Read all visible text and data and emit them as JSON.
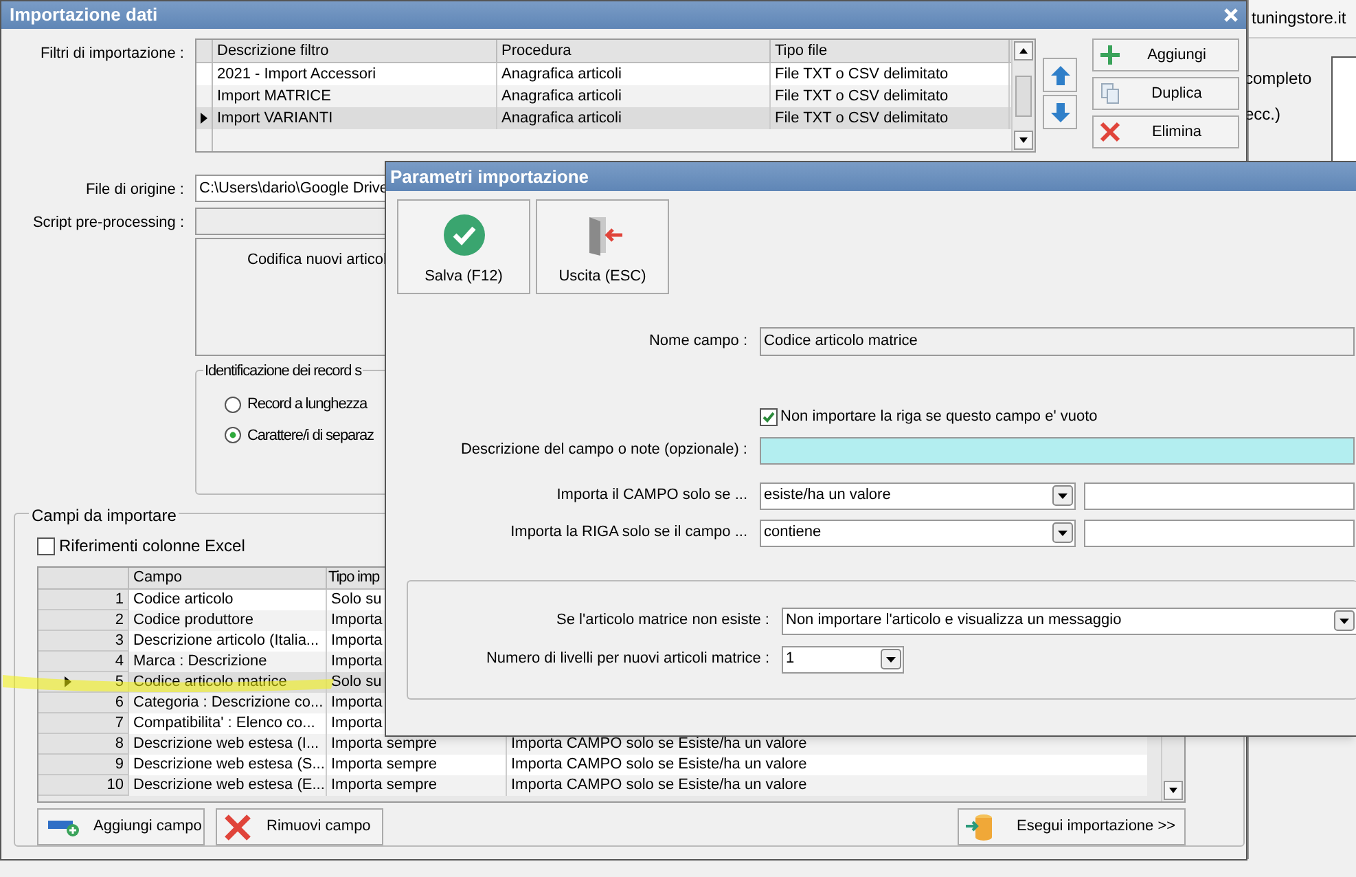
{
  "background_window": {
    "title": "tuningstore.it",
    "texts": [
      "completo",
      "ecc.)"
    ]
  },
  "main_window": {
    "title": "Importazione dati",
    "filters": {
      "label": "Filtri di importazione :",
      "columns": [
        "Descrizione filtro",
        "Procedura",
        "Tipo file"
      ],
      "rows": [
        {
          "cells": [
            "2021 - Import Accessori",
            "Anagrafica articoli",
            "File TXT o CSV delimitato"
          ],
          "selected": false
        },
        {
          "cells": [
            "Import MATRICE",
            "Anagrafica articoli",
            "File TXT o CSV delimitato"
          ],
          "selected": false
        },
        {
          "cells": [
            "Import VARIANTI",
            "Anagrafica articoli",
            "File TXT o CSV delimitato"
          ],
          "selected": true
        }
      ]
    },
    "filter_buttons": [
      {
        "kind": "add",
        "label": "Aggiungi"
      },
      {
        "kind": "copy",
        "label": "Duplica"
      },
      {
        "kind": "delete",
        "label": "Elimina"
      }
    ],
    "source_file": {
      "label": "File di origine :",
      "value": "C:\\Users\\dario\\Google Drive"
    },
    "script": {
      "label": "Script pre-processing :"
    },
    "encoding_text": "Codifica nuovi articol",
    "record_group": {
      "title": "Identificazione dei record s",
      "options": [
        {
          "label": "Record a lunghezza",
          "selected": false
        },
        {
          "label": "Carattere/i di separaz",
          "selected": true
        }
      ]
    },
    "fields_group": {
      "title": "Campi da importare",
      "excel_refs": {
        "label": "Riferimenti colonne Excel",
        "checked": false
      },
      "columns": [
        "Campo",
        "Tipo imp"
      ],
      "rows": [
        {
          "number": "1",
          "field": "Codice articolo",
          "type": "Solo su",
          "selected": false
        },
        {
          "number": "2",
          "field": "Codice produttore",
          "type": "Importa",
          "selected": false
        },
        {
          "number": "3",
          "field": "Descrizione articolo (Italia...",
          "type": "Importa",
          "selected": false
        },
        {
          "number": "4",
          "field": "Marca : Descrizione",
          "type": "Importa",
          "selected": false
        },
        {
          "number": "5",
          "field": "Codice articolo matrice",
          "type": "Solo su",
          "selected": true
        },
        {
          "number": "6",
          "field": "Categoria : Descrizione co...",
          "type": "Importa",
          "selected": false
        },
        {
          "number": "7",
          "field": "Compatibilita' : Elenco co...",
          "type": "Importa",
          "selected": false
        },
        {
          "number": "8",
          "field": "Descrizione web estesa (I...",
          "type": "Importa sempre",
          "condition": "Importa CAMPO solo se Esiste/ha un valore",
          "selected": false
        },
        {
          "number": "9",
          "field": "Descrizione web estesa (S...",
          "type": "Importa sempre",
          "condition": "Importa CAMPO solo se Esiste/ha un valore",
          "selected": false
        },
        {
          "number": "10",
          "field": "Descrizione web estesa (E...",
          "type": "Importa sempre",
          "condition": "Importa CAMPO solo se Esiste/ha un valore",
          "selected": false
        }
      ]
    },
    "buttons": [
      {
        "kind": "add_field",
        "label": "Aggiungi campo"
      },
      {
        "kind": "remove",
        "label": "Rimuovi campo"
      },
      {
        "kind": "run",
        "label": "Esegui importazione >>"
      }
    ]
  },
  "dialog": {
    "title": "Parametri importazione",
    "toolbar": [
      {
        "kind": "save",
        "label": "Salva (F12)"
      },
      {
        "kind": "exit",
        "label": "Uscita (ESC)"
      }
    ],
    "field_name": {
      "label": "Nome campo :",
      "value": "Codice articolo matrice"
    },
    "skip_empty": {
      "label": "Non importare la riga se questo campo e' vuoto",
      "checked": true
    },
    "notes": {
      "label": "Descrizione del campo o note (opzionale) :"
    },
    "field_condition": {
      "label": "Importa il CAMPO solo se ...",
      "value": "esiste/ha un valore"
    },
    "row_condition": {
      "label": "Importa la RIGA solo se il campo ...",
      "value": "contiene"
    },
    "missing_parent": {
      "label": "Se l'articolo matrice non esiste :",
      "value": "Non importare l'articolo e visualizza un messaggio"
    },
    "levels": {
      "label": "Numero di livelli per nuovi articoli matrice :",
      "value": "1"
    }
  }
}
